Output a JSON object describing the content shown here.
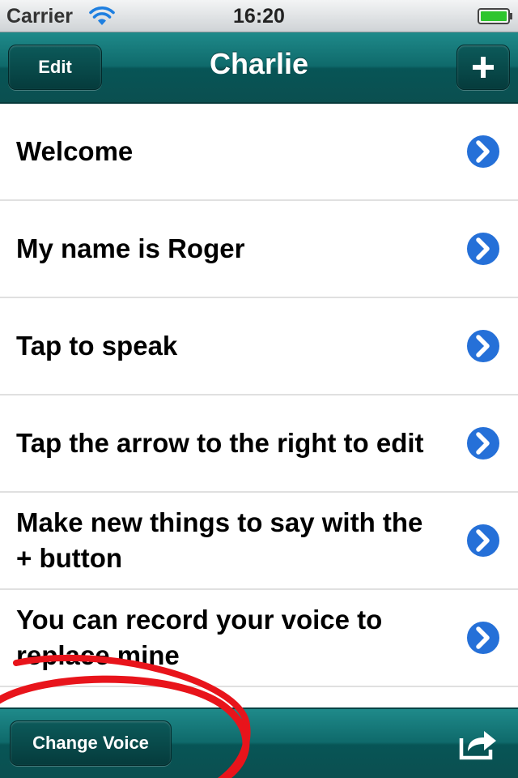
{
  "status_bar": {
    "carrier": "Carrier",
    "time": "16:20",
    "wifi_icon": "wifi-icon",
    "battery_icon": "battery-icon",
    "battery_color": "#2ec52e"
  },
  "nav_bar": {
    "title": "Charlie",
    "edit_label": "Edit",
    "add_icon": "plus-icon",
    "color": "#0f6a6b"
  },
  "phrases": [
    {
      "label": "Welcome",
      "icon": "disclosure-arrow-icon"
    },
    {
      "label": "My name is Roger",
      "icon": "disclosure-arrow-icon"
    },
    {
      "label": "Tap to speak",
      "icon": "disclosure-arrow-icon"
    },
    {
      "label": "Tap the arrow to the right to edit",
      "icon": "disclosure-arrow-icon"
    },
    {
      "label": "Make new things to say with the + button",
      "icon": "disclosure-arrow-icon"
    },
    {
      "label": "You can record your voice to replace mine",
      "icon": "disclosure-arrow-icon"
    },
    {
      "label": "",
      "icon": ""
    }
  ],
  "toolbar": {
    "change_voice_label": "Change Voice",
    "share_icon": "share-icon"
  },
  "annotation": {
    "shape": "ellipse",
    "color": "#e8141b"
  }
}
